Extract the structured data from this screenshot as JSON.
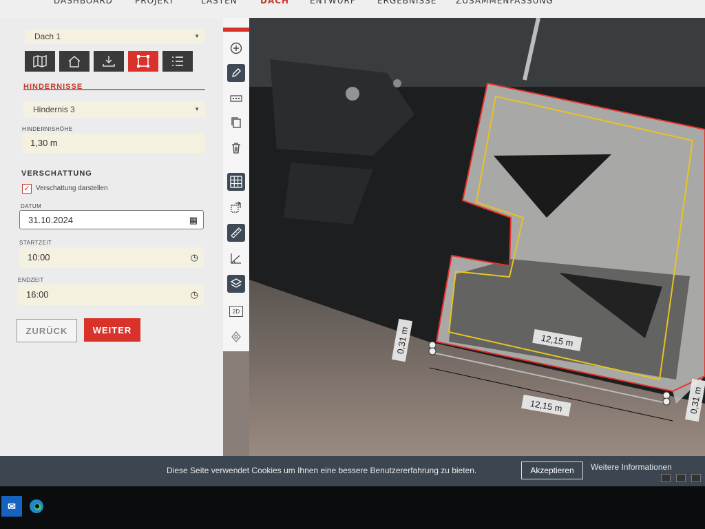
{
  "nav": {
    "tabs": [
      {
        "label": "DASHBOARD",
        "active": false
      },
      {
        "label": "PROJEKT",
        "active": false
      },
      {
        "label": "LASTEN",
        "active": false
      },
      {
        "label": "DACH",
        "active": true
      },
      {
        "label": "ENTWURF",
        "active": false
      },
      {
        "label": "ERGEBNISSE",
        "active": false
      },
      {
        "label": "ZUSAMMENFASSUNG",
        "active": false
      }
    ]
  },
  "panel": {
    "roof_select": "Dach 1",
    "view_buttons": [
      "map-icon",
      "house-icon",
      "download-icon",
      "rectangle-icon",
      "list-icon"
    ],
    "obstacles_title": "HINDERNISSE",
    "obstacle_select": "Hindernis 3",
    "height_label": "HINDERNISHÖHE",
    "height_value": "1,30 m",
    "shading_title": "VERSCHATTUNG",
    "shading_checkbox_label": "Verschattung darstellen",
    "shading_checked": true,
    "date_label": "DATUM",
    "date_value": "31.10.2024",
    "start_label": "STARTZEIT",
    "start_value": "10:00",
    "end_label": "ENDZEIT",
    "end_value": "16:00",
    "back_button": "ZURÜCK",
    "next_button": "WEITER"
  },
  "toolbar": {
    "icons": [
      "plus-circle-icon",
      "pencil-icon",
      "tag-icon",
      "copy-icon",
      "trash-icon",
      "grid-icon",
      "rotate-icon",
      "ruler-icon",
      "angle-icon",
      "layers-icon",
      "2d-toggle-icon",
      "location-icon"
    ],
    "mode_label": "2D"
  },
  "map": {
    "dimension_top": "12,15 m",
    "dimension_bottom": "12,15 m",
    "dimension_left": "0,31 m",
    "dimension_right": "0,31 m"
  },
  "cookie": {
    "message": "Diese Seite verwendet Cookies um Ihnen eine bessere Benutzererfahrung zu bieten.",
    "accept": "Akzeptieren",
    "more": "Weitere Informationen"
  },
  "colors": {
    "accent": "#d9322a",
    "panel_bg": "#ececec",
    "field_bg": "#f5f1e0",
    "cookie_bg": "#3c4650",
    "roof_outline": "#e8322a",
    "inner_outline": "#e8c320"
  }
}
